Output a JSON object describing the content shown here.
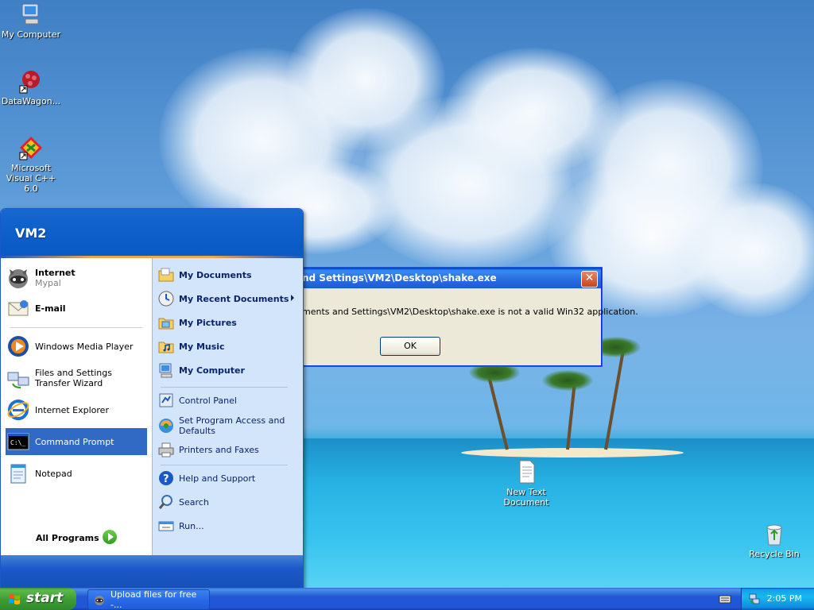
{
  "desktop": {
    "icons": [
      {
        "name": "my-computer",
        "label": "My Computer"
      },
      {
        "name": "datawagon",
        "label": "DataWagon..."
      },
      {
        "name": "msvc",
        "label": "Microsoft Visual C++ 6.0"
      },
      {
        "name": "new-text-document",
        "label": "New Text Document"
      },
      {
        "name": "recycle-bin",
        "label": "Recycle Bin"
      }
    ]
  },
  "dialog": {
    "title": "nd Settings\\VM2\\Desktop\\shake.exe",
    "message": "ments and Settings\\VM2\\Desktop\\shake.exe is not a valid Win32 application.",
    "ok_label": "OK",
    "close_label": "✕"
  },
  "start_menu": {
    "user": "VM2",
    "pinned": [
      {
        "label": "Internet",
        "sub": "Mypal"
      },
      {
        "label": "E-mail",
        "sub": ""
      }
    ],
    "recent": [
      {
        "label": "Windows Media Player"
      },
      {
        "label": "Files and Settings Transfer Wizard"
      },
      {
        "label": "Internet Explorer"
      },
      {
        "label": "Command Prompt"
      },
      {
        "label": "Notepad"
      }
    ],
    "all_programs": "All Programs",
    "right": [
      {
        "label": "My Documents"
      },
      {
        "label": "My Recent Documents"
      },
      {
        "label": "My Pictures"
      },
      {
        "label": "My Music"
      },
      {
        "label": "My Computer"
      },
      {
        "label": "Control Panel"
      },
      {
        "label": "Set Program Access and Defaults"
      },
      {
        "label": "Printers and Faxes"
      },
      {
        "label": "Help and Support"
      },
      {
        "label": "Search"
      },
      {
        "label": "Run..."
      }
    ]
  },
  "taskbar": {
    "start_label": "start",
    "task_label": "Upload files for free -...",
    "clock": "2:05 PM"
  },
  "colors": {
    "xp_blue": "#2157d7",
    "start_green": "#3f9d35",
    "menu_highlight": "#316ac5",
    "right_pane": "#d3e5fa"
  }
}
